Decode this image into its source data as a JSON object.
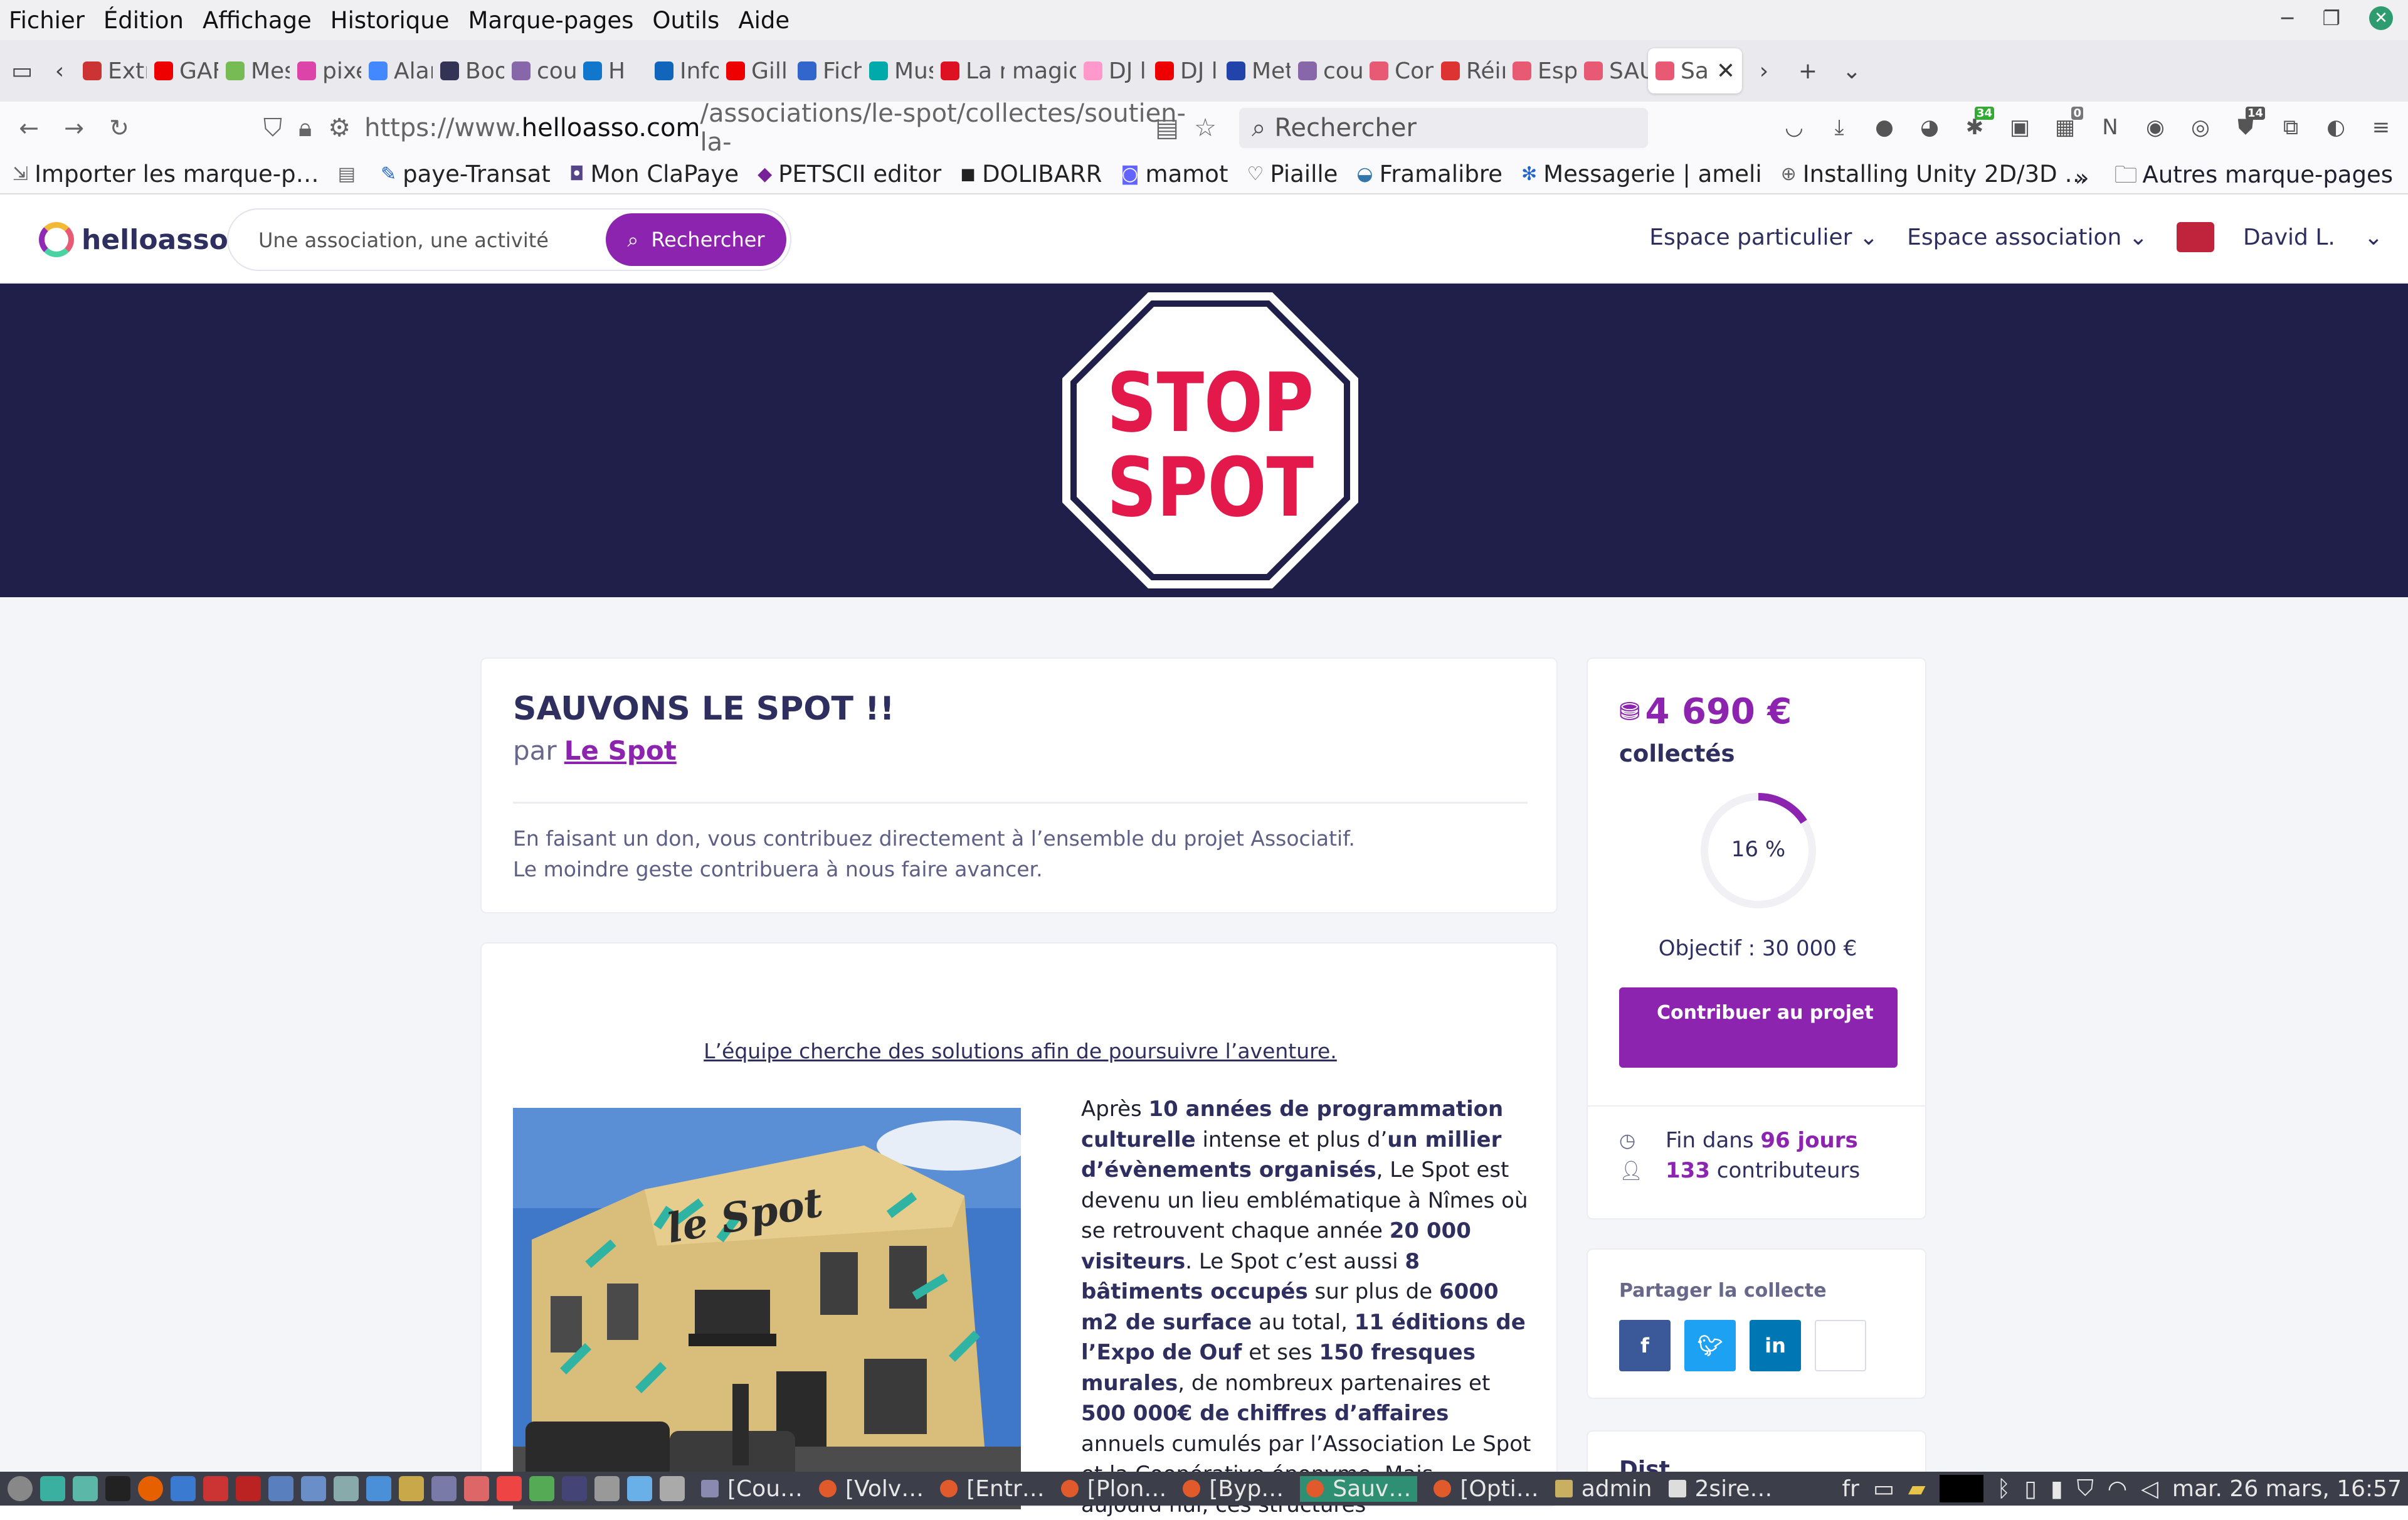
{
  "menubar": {
    "items": [
      "Fichier",
      "Édition",
      "Affichage",
      "Historique",
      "Marque-pages",
      "Outils",
      "Aide"
    ]
  },
  "tabs": [
    "Extr",
    "GAF",
    "Mes",
    "pixe",
    "Alar",
    "Boo",
    "cou",
    "H",
    "Info",
    "Gill",
    "Fich",
    "Mus",
    "La r",
    "magic",
    "DJ l",
    "DJ l",
    "Met",
    "cou",
    "Con",
    "Réir",
    "Esp",
    "SAU",
    "Sa"
  ],
  "nav": {
    "url_prefix": "https://www.",
    "url_host": "helloasso.com",
    "url_rest": "/associations/le-spot/collectes/soutien-la-",
    "search_placeholder": "Rechercher",
    "badges": {
      "ext1": "34",
      "ext2": "0",
      "ext3": "14"
    }
  },
  "bookmarks": [
    "Importer les marque-p…",
    "paye-Transat",
    "Mon ClaPaye",
    "PETSCII editor",
    "DOLIBARR",
    "mamot",
    "Piaille",
    "Framalibre",
    "Messagerie | ameli",
    "Installing Unity 2D/3D …"
  ],
  "bookmarks_other": "Autres marque-pages",
  "site": {
    "logo": "helloasso",
    "search_placeholder": "Une association, une activité",
    "search_button": "Rechercher",
    "nav_particulier": "Espace particulier",
    "nav_association": "Espace association",
    "user": "David L."
  },
  "banner": {
    "line1": "STOP",
    "line2": "SPOT"
  },
  "campaign": {
    "title": "SAUVONS LE SPOT !!",
    "by": "par",
    "org": "Le Spot",
    "desc1": "En faisant un don, vous contribuez directement à l’ensemble du projet Associatif.",
    "desc2": "Le moindre geste contribuera à nous faire avancer.",
    "tagline": "L’équipe cherche des solutions afin de poursuivre l’aventure.",
    "body": {
      "p1": "Après ",
      "b1": "10 années de programmation culturelle",
      "p2": " intense et plus d’",
      "b2": "un millier d’évènements organisés",
      "p3": ", Le Spot est devenu un lieu emblématique à Nîmes où se retrouvent chaque année ",
      "b3": "20 000 visiteurs",
      "p4": ". Le Spot c’est aussi ",
      "b4": "8 bâtiments occupés",
      "p5": " sur plus de ",
      "b5": "6000 m2 de surface",
      "p6": " au total, ",
      "b6": "11 éditions de l’Expo de Ouf",
      "p7": " et ses ",
      "b7": "150 fresques murales",
      "p8": ", de nombreux partenaires et ",
      "b8": "500 000€ de chiffres d’affaires",
      "p9": " annuels cumulés par l’Association Le Spot et la Coopérative éponyme. Mais aujourd’hui, ces structures"
    }
  },
  "funding": {
    "amount": "4 690 €",
    "collected_label": "collectés",
    "percent": 16,
    "percent_label": "16 %",
    "objective": "Objectif : 30 000 €",
    "button": "Contribuer au projet",
    "end_prefix": "Fin dans",
    "end_value": "96 jours",
    "contributors_value": "133",
    "contributors_label": "contributeurs"
  },
  "share": {
    "title": "Partager la collecte",
    "buttons": [
      "f",
      "t",
      "in",
      "link"
    ]
  },
  "next_card_title": "Dist",
  "taskbar": {
    "windows": [
      "[Cou…",
      "[Volv…",
      "[Entr…",
      "[Plon…",
      "[Byp…",
      "Sauv…",
      "[Opti…",
      "admin",
      "2sire…"
    ],
    "lang": "fr",
    "clock": "mar. 26 mars, 16:57"
  },
  "colors": {
    "brand_purple": "#8d24b0",
    "navy": "#2e2f5e",
    "banner": "#1f1f4a",
    "stop_red": "#e3194b"
  }
}
